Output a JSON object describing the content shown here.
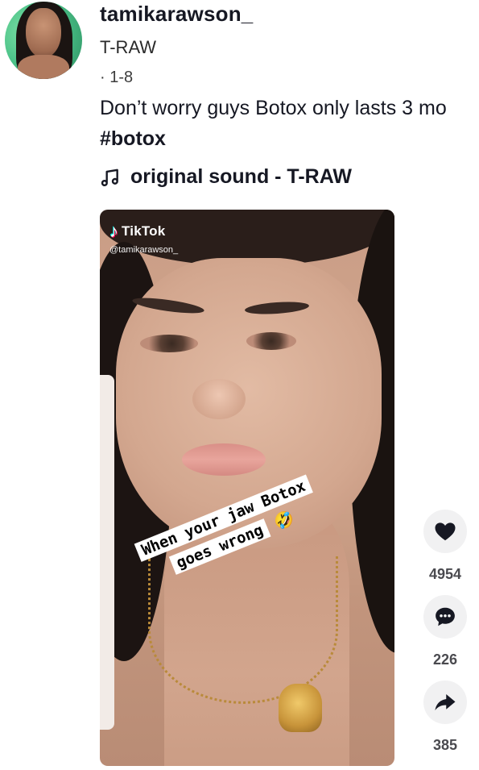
{
  "author": {
    "username": "tamikarawson_",
    "nickname": "T-RAW",
    "date": "· 1-8"
  },
  "post": {
    "caption": "Don’t worry guys Botox only lasts 3 mo",
    "hashtag": "#botox",
    "sound": "original sound - T-RAW"
  },
  "video": {
    "watermark_brand": "TikTok",
    "watermark_handle": "@tamikarawson_",
    "overlay_line1": "When your jaw Botox",
    "overlay_line2": "goes wrong",
    "overlay_emoji": "🤣"
  },
  "actions": {
    "likes": "4954",
    "comments": "226",
    "shares": "385"
  },
  "icons": {
    "like": "heart-icon",
    "comment": "comment-bubble-icon",
    "share": "share-arrow-icon",
    "sound": "music-note-icon"
  },
  "colors": {
    "text": "#161823",
    "action_bg": "#f1f1f2",
    "action_count": "#4a4a4f"
  }
}
